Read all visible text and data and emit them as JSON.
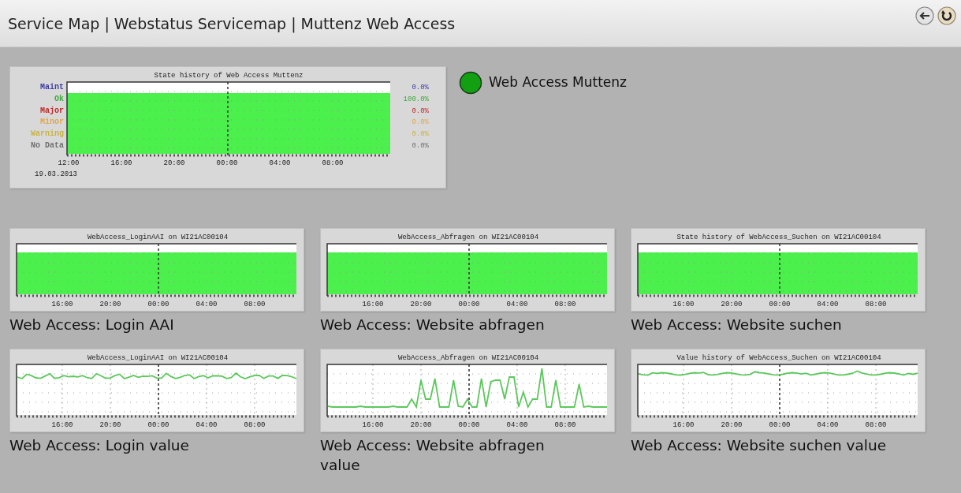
{
  "title": "Service Map | Webstatus Servicemap | Muttenz Web Access",
  "toolbar": [
    {
      "kind": "back"
    },
    {
      "kind": "refresh"
    }
  ],
  "overview": {
    "graph": {
      "title": "State history of Web Access Muttenz",
      "legend": [
        {
          "label": "Maint",
          "value": "0.0%",
          "color": "#3c3ca8"
        },
        {
          "label": "Ok",
          "value": "100.0%",
          "color": "#3caa3c"
        },
        {
          "label": "Major",
          "value": "0.0%",
          "color": "#c02828"
        },
        {
          "label": "Minor",
          "value": "0.0%",
          "color": "#e0a850"
        },
        {
          "label": "Warning",
          "value": "0.0%",
          "color": "#c8b440"
        },
        {
          "label": "No Data",
          "value": "0.0%",
          "color": "#707070"
        }
      ],
      "x_labels": [
        "12:00",
        "16:00",
        "20:00",
        "00:00",
        "04:00",
        "08:00"
      ],
      "date": "19.03.2013"
    },
    "status": {
      "label": "Web Access Muttenz",
      "color": "#12a012"
    }
  },
  "services": [
    {
      "graph": {
        "kind": "state",
        "title": "WebAccess_LoginAAI on WI21AC00104",
        "x_labels": [
          "16:00",
          "20:00",
          "00:00",
          "04:00",
          "08:00"
        ]
      },
      "label": "Web Access: Login AAI"
    },
    {
      "graph": {
        "kind": "state",
        "title": "WebAccess_Abfragen on WI21AC00104",
        "x_labels": [
          "16:00",
          "20:00",
          "00:00",
          "04:00",
          "08:00"
        ]
      },
      "label": "Web Access: Website abfragen"
    },
    {
      "graph": {
        "kind": "state",
        "title": "State history of WebAccess_Suchen on WI21AC00104",
        "x_labels": [
          "16:00",
          "20:00",
          "00:00",
          "04:00",
          "08:00"
        ]
      },
      "label": "Web Access: Website suchen"
    },
    {
      "graph": {
        "kind": "value",
        "title": "WebAccess_LoginAAI on WI21AC00104",
        "x_labels": [
          "16:00",
          "20:00",
          "00:00",
          "04:00",
          "08:00"
        ]
      },
      "label": "Web Access: Login value"
    },
    {
      "graph": {
        "kind": "value",
        "title": "WebAccess_Abfragen on WI21AC00104",
        "x_labels": [
          "16:00",
          "20:00",
          "00:00",
          "04:00",
          "08:00"
        ]
      },
      "label": "Web Access: Website abfragen value"
    },
    {
      "graph": {
        "kind": "value",
        "title": "Value history of WebAccess_Suchen on WI21AC00104",
        "x_labels": [
          "16:00",
          "20:00",
          "00:00",
          "04:00",
          "08:00"
        ]
      },
      "label": "Web Access: Website suchen value"
    }
  ]
}
